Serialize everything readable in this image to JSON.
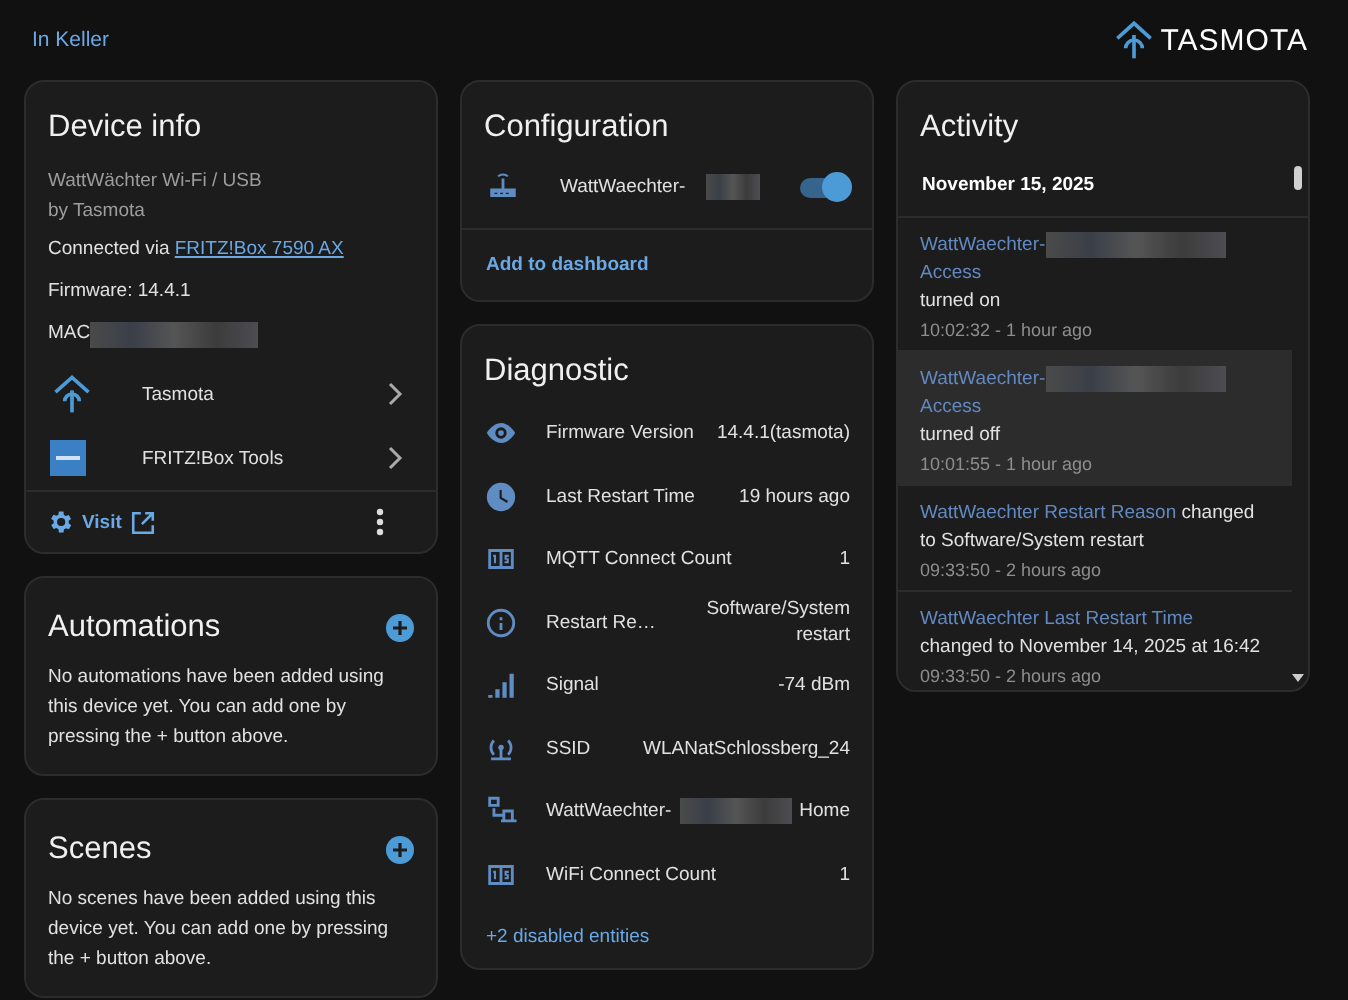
{
  "breadcrumb": "In Keller",
  "brand": {
    "name": "TASMOTA"
  },
  "device_info": {
    "title": "Device info",
    "model": "WattWächter Wi-Fi / USB",
    "manufacturer": "by Tasmota",
    "connected_label": "Connected via",
    "connected_link": "FRITZ!Box 7590 AX",
    "firmware": "Firmware: 14.4.1",
    "mac_label": "MAC",
    "integrations": [
      {
        "kind": "tasmota",
        "label": "Tasmota"
      },
      {
        "kind": "fritzbox",
        "label": "FRITZ!Box Tools"
      }
    ],
    "visit": "Visit"
  },
  "automations": {
    "title": "Automations",
    "text": "No automations have been added using this device yet. You can add one by pressing the + button above."
  },
  "scenes": {
    "title": "Scenes",
    "text": "No scenes have been added using this device yet. You can add one by pressing the + button above."
  },
  "configuration": {
    "title": "Configuration",
    "entities": [
      {
        "label": "WattWaechter-",
        "redacted": true,
        "on": true
      }
    ],
    "add_link": "Add to dashboard"
  },
  "diagnostic": {
    "title": "Diagnostic",
    "rows": [
      {
        "kind": "eye",
        "label": "Firmware Version",
        "value": "14.4.1(tasmota)",
        "redacted": false
      },
      {
        "kind": "clock",
        "label": "Last Restart Time",
        "value": "19 hours ago",
        "redacted": false
      },
      {
        "kind": "counter",
        "label": "MQTT Connect Count",
        "value": "1",
        "redacted": false
      },
      {
        "kind": "info",
        "label": "Restart Re…",
        "value": "Software/System restart",
        "redacted": false
      },
      {
        "kind": "signal",
        "label": "Signal",
        "value": "-74 dBm",
        "redacted": false
      },
      {
        "kind": "antenna",
        "label": "SSID",
        "value": "WLANatSchlossberg_24",
        "redacted": false
      },
      {
        "kind": "network",
        "label": "WattWaechter-",
        "value": "Home",
        "redacted": true
      },
      {
        "kind": "counter",
        "label": "WiFi Connect Count",
        "value": "1",
        "redacted": false
      }
    ],
    "more_link": "+2 disabled entities"
  },
  "activity": {
    "title": "Activity",
    "date": "November 15, 2025",
    "entries": [
      {
        "entity": "WattWaechter-",
        "redacted": true,
        "entity_suffix": "Access",
        "message": "turned on",
        "time": "10:02:32 - 1 hour ago",
        "hovered": false
      },
      {
        "entity": "WattWaechter-",
        "redacted": true,
        "entity_suffix": "Access",
        "message": "turned off",
        "time": "10:01:55 - 1 hour ago",
        "hovered": true
      },
      {
        "entity": "WattWaechter Restart Reason",
        "redacted": false,
        "message": "changed to Software/System restart",
        "time": "09:33:50 - 2 hours ago",
        "hovered": false
      },
      {
        "entity": "WattWaechter Last Restart Time",
        "redacted": false,
        "message": "changed to November 14, 2025 at 16:42",
        "time": "09:33:50 - 2 hours ago",
        "hovered": false
      }
    ]
  }
}
